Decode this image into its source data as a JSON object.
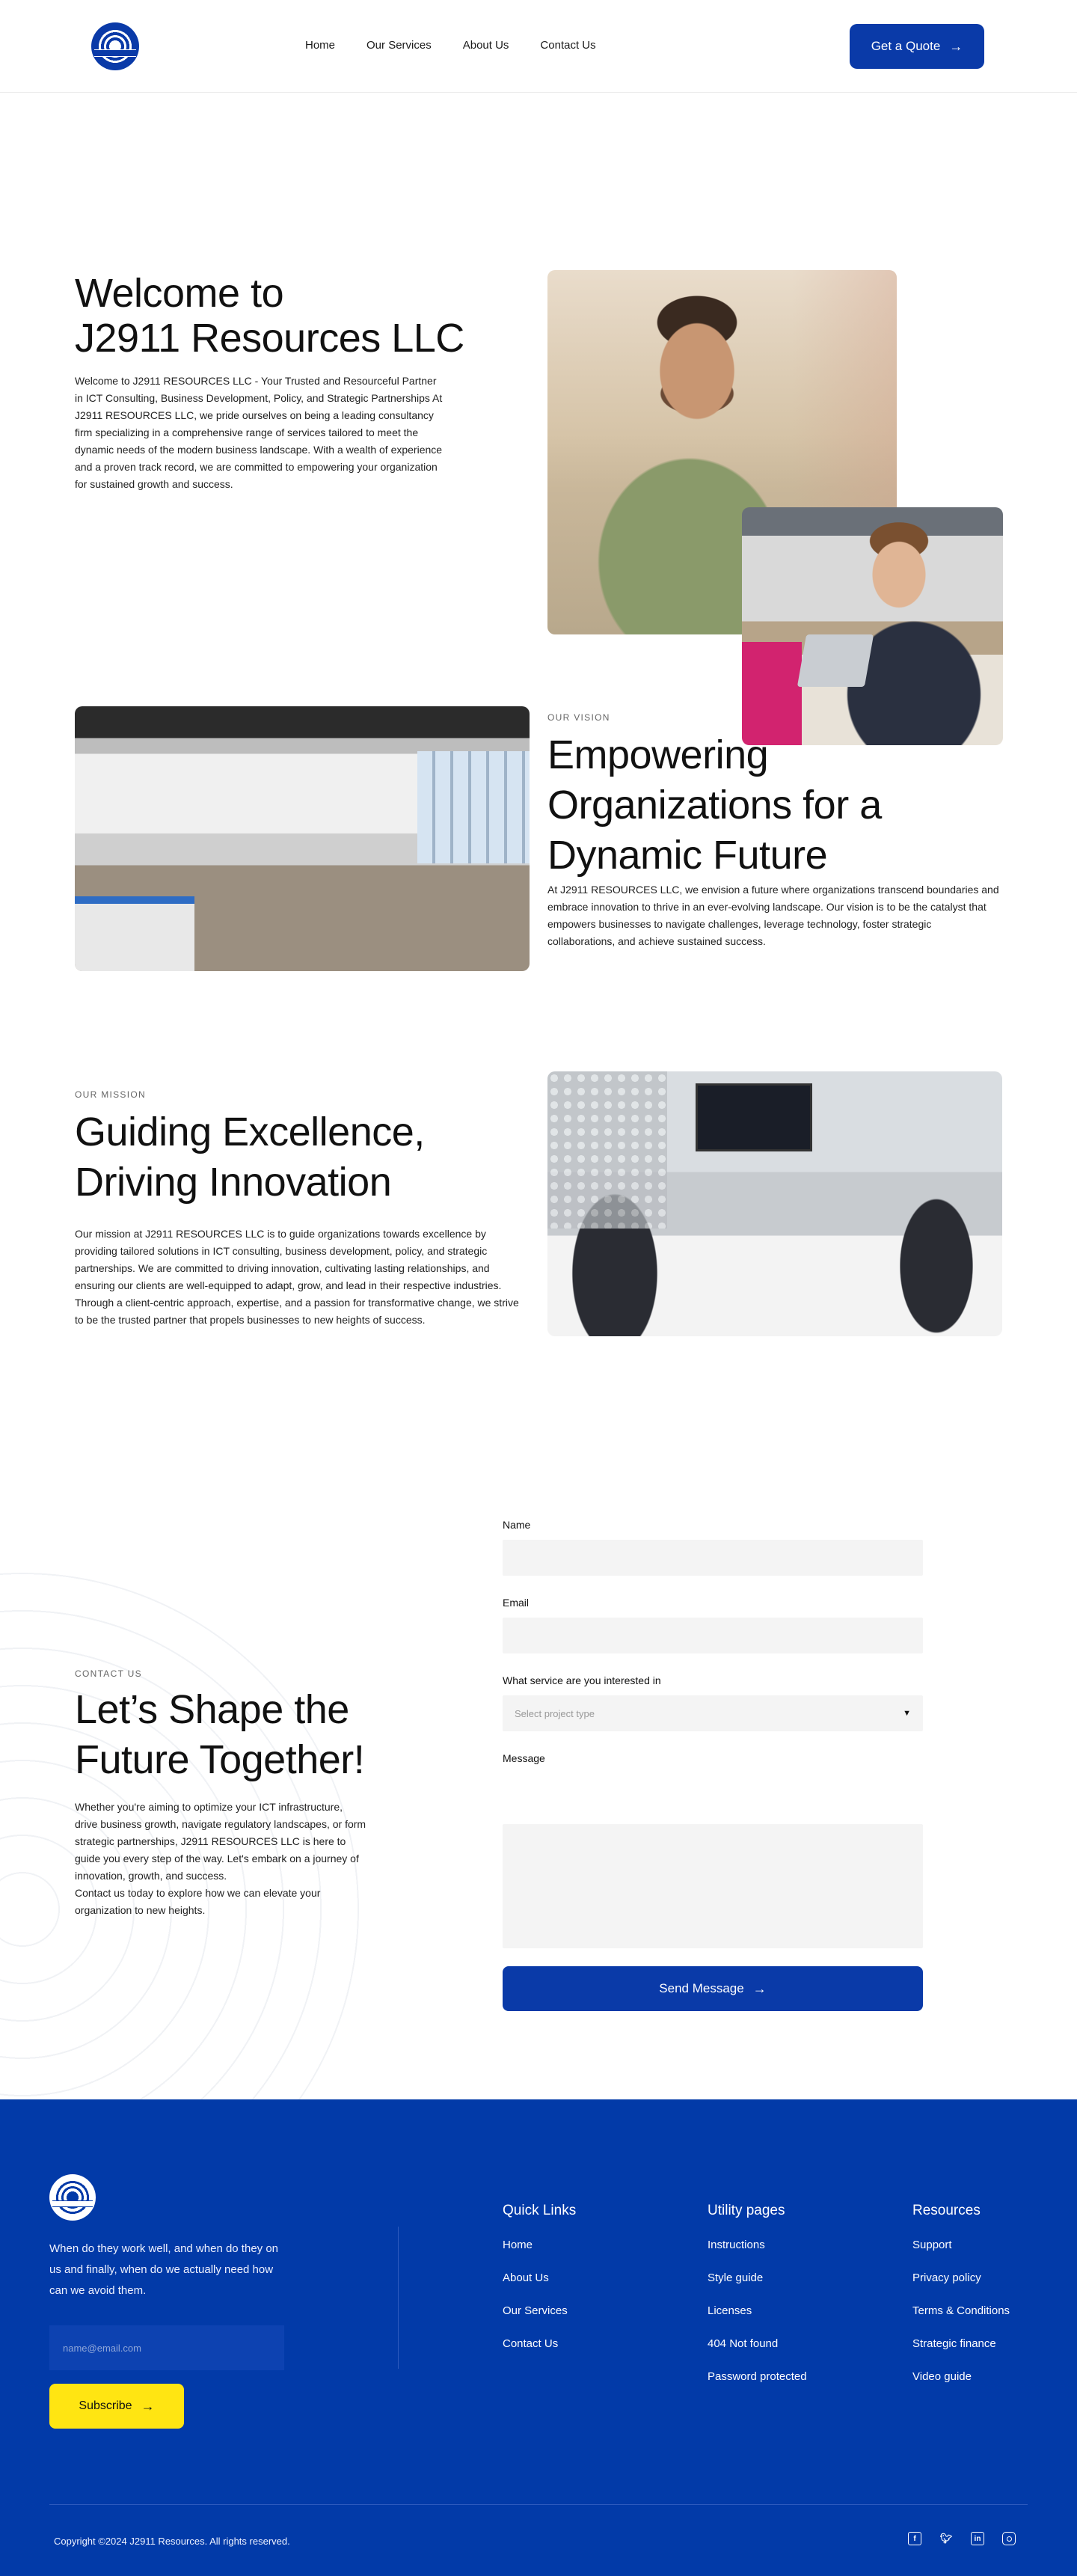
{
  "header": {
    "nav": [
      "Home",
      "Our Services",
      "About Us",
      "Contact Us"
    ],
    "quote_button": "Get a Quote",
    "arrow_icon": "arrow-right-icon"
  },
  "hero": {
    "title_line1": "Welcome to",
    "title_line2": "J2911 Resources LLC",
    "text": "Welcome to J2911 RESOURCES LLC - Your Trusted and Resourceful Partner in ICT Consulting, Business Development, Policy, and Strategic Partnerships At J2911 RESOURCES LLC, we pride ourselves on being a leading consultancy firm specializing in a comprehensive range of services tailored to meet the dynamic needs of the modern business landscape. With a wealth of experience and a proven track record, we are committed to empowering your organization for sustained growth and success."
  },
  "vision": {
    "eyebrow": "OUR VISION",
    "title": "Empowering Organizations for a Dynamic Future",
    "text": "At J2911 RESOURCES LLC, we envision a future where organizations transcend boundaries and embrace innovation to thrive in an ever-evolving landscape. Our vision is to be the catalyst that empowers businesses to navigate challenges, leverage technology, foster strategic collaborations, and achieve sustained success."
  },
  "mission": {
    "eyebrow": "OUR MISSION",
    "title": "Guiding Excellence, Driving Innovation",
    "text": "Our mission at J2911 RESOURCES LLC is to guide organizations towards excellence by providing tailored solutions in ICT consulting, business development, policy, and strategic partnerships. We are committed to driving innovation, cultivating lasting relationships, and ensuring our clients are well-equipped to adapt, grow, and lead in their respective industries. Through a client-centric approach, expertise, and a passion for transformative change, we strive to be the trusted partner that propels businesses to new heights of success."
  },
  "contact": {
    "eyebrow": "CONTACT US",
    "title": "Let’s Shape the Future Together!",
    "text": "Whether you're aiming to optimize your ICT infrastructure, drive business growth, navigate regulatory landscapes, or form strategic partnerships, J2911 RESOURCES LLC is here to guide you every step of the way. Let's embark on a journey of innovation, growth, and success.\nContact us today to explore how we can elevate your organization to new heights.",
    "form": {
      "name_label": "Name",
      "name_value": "",
      "email_label": "Email",
      "email_value": "",
      "service_label": "What service are you interested in",
      "service_placeholder": "Select project type",
      "message_label": "Message",
      "send_button": "Send Message"
    }
  },
  "footer": {
    "blurb": "When do they work well, and when do they on us and finally, when do we actually need how can we avoid them.",
    "email_placeholder": "name@email.com",
    "subscribe_button": "Subscribe",
    "columns": [
      {
        "title": "Quick Links",
        "links": [
          "Home",
          "About Us",
          "Our Services",
          "Contact Us"
        ]
      },
      {
        "title": "Utility pages",
        "links": [
          "Instructions",
          "Style guide",
          "Licenses",
          "404 Not found",
          "Password protected"
        ]
      },
      {
        "title": "Resources",
        "links": [
          "Support",
          "Privacy policy",
          "Terms & Conditions",
          "Strategic finance",
          "Video guide"
        ]
      }
    ],
    "copyright": "Copyright ©2024 J2911 Resources. All rights reserved.",
    "socials": [
      "facebook-icon",
      "twitter-icon",
      "linkedin-icon",
      "instagram-icon"
    ]
  },
  "colors": {
    "brand_blue": "#0a3aa8",
    "footer_blue": "#023aa8",
    "accent_yellow": "#ffe512"
  }
}
